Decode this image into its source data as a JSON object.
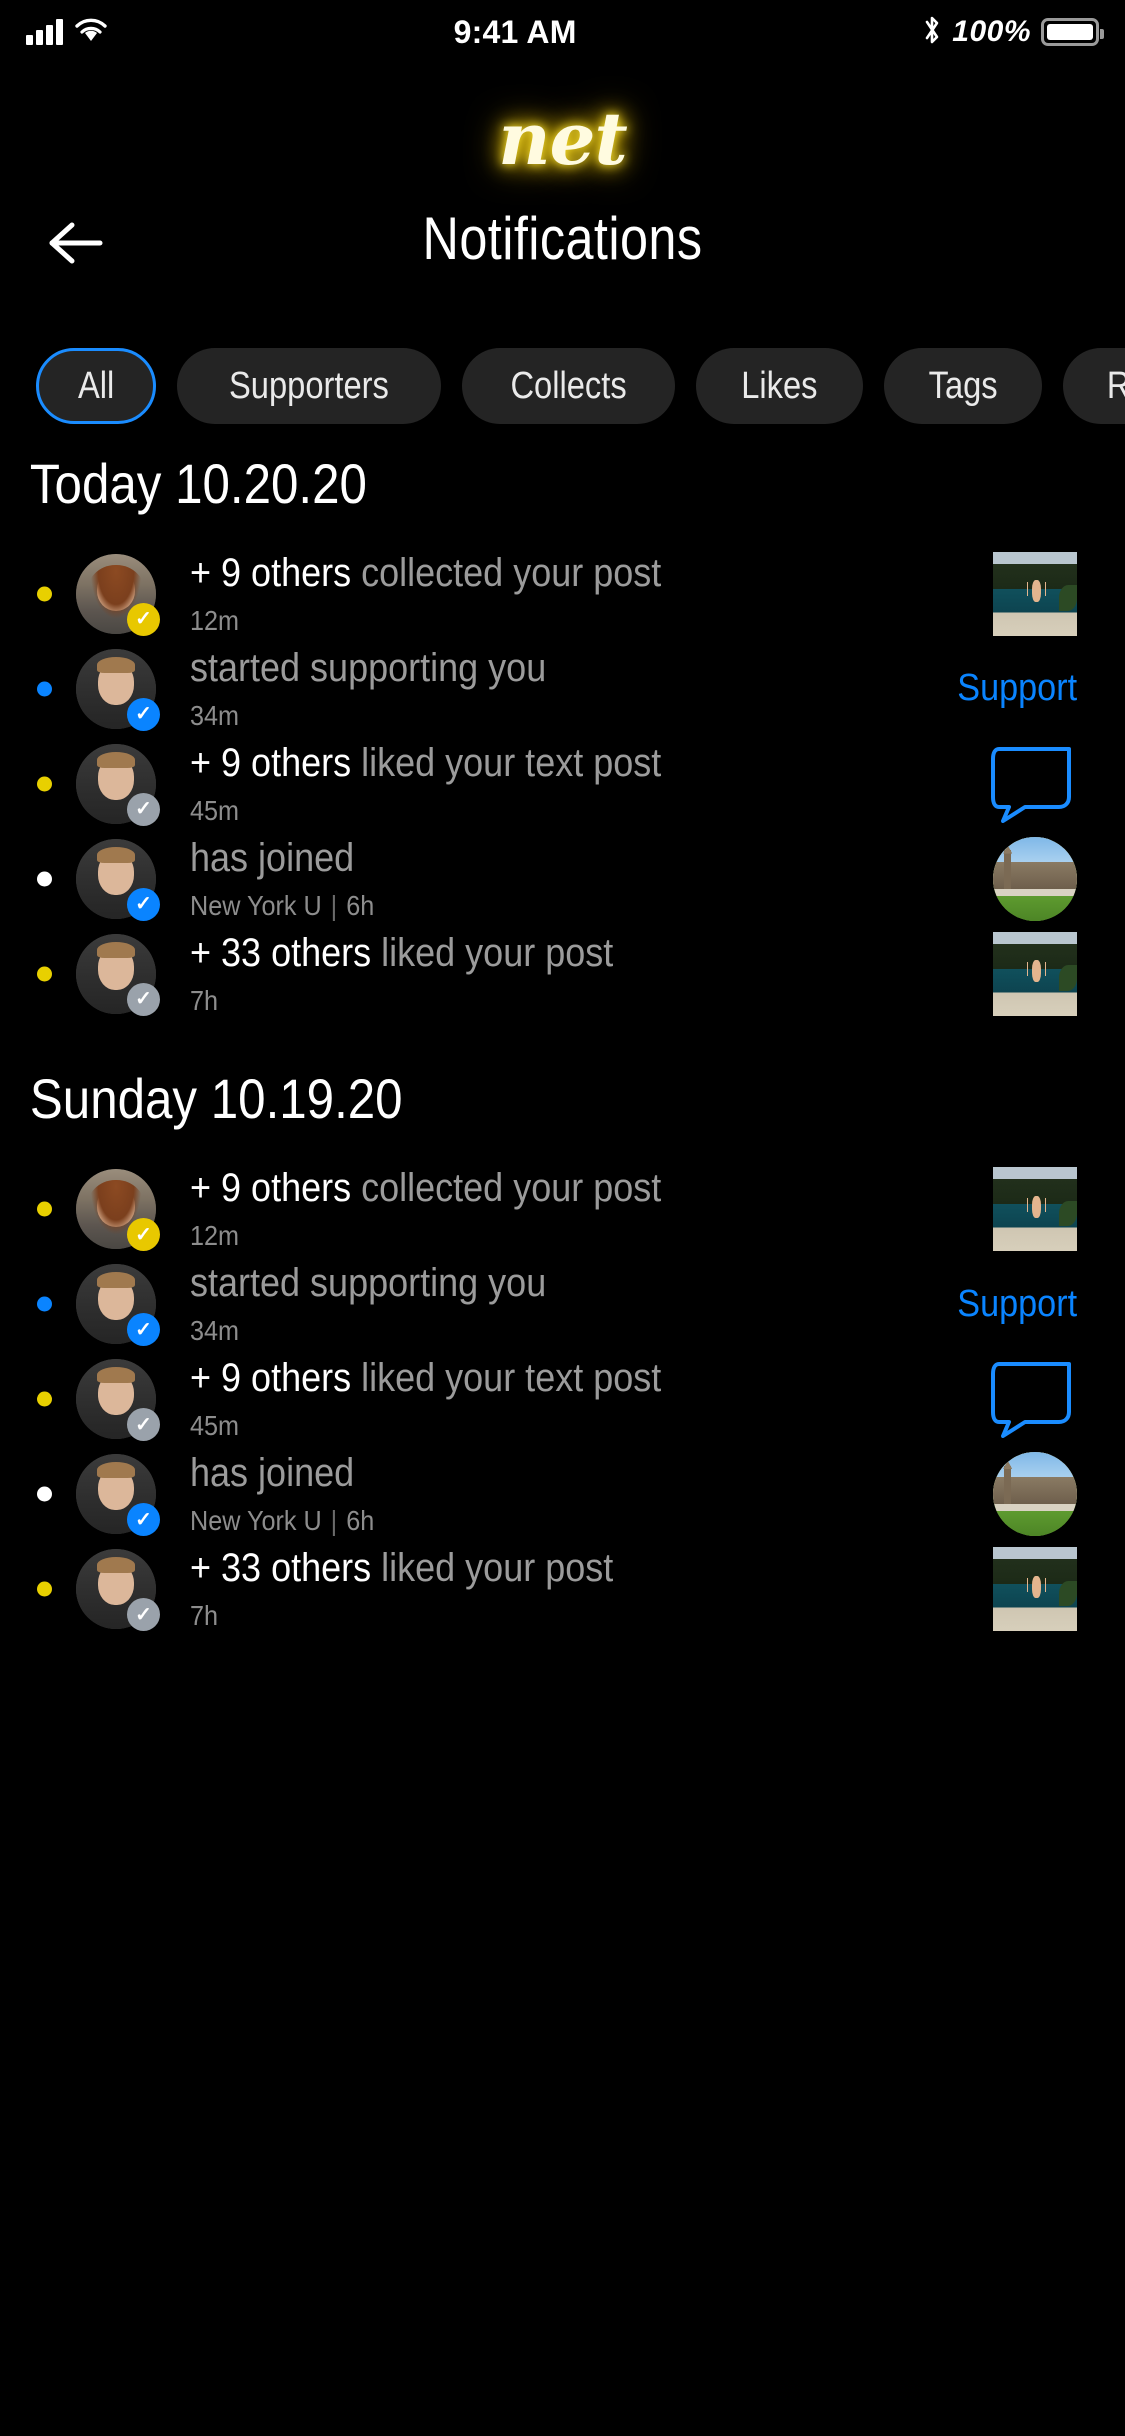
{
  "status_bar": {
    "signal_icon": "cellular-bars-icon",
    "wifi_icon": "wifi-icon",
    "time": "9:41 AM",
    "bluetooth_icon": "bluetooth-icon",
    "battery_percent": "100%",
    "battery_icon": "battery-full-icon"
  },
  "brand": {
    "logo_text": "net",
    "glow_color": "#ffd400"
  },
  "header": {
    "back_icon": "arrow-left-icon",
    "title": "Notifications"
  },
  "filters": {
    "selected": "All",
    "accent": "#1a8cff",
    "chips": [
      {
        "label": "All",
        "active": true
      },
      {
        "label": "Supporters",
        "active": false
      },
      {
        "label": "Collects",
        "active": false
      },
      {
        "label": "Likes",
        "active": false
      },
      {
        "label": "Tags",
        "active": false
      },
      {
        "label": "Rep",
        "active": false
      }
    ]
  },
  "sections": [
    {
      "title": "Today 10.20.20",
      "rows": [
        {
          "dot": "yellow",
          "avatar": "girl",
          "badge": "yellow",
          "badge_icon": "check-badge-icon",
          "strong": "+ 9 others",
          "muted": "collected your post",
          "time": "12m",
          "meta": "",
          "right_type": "thumb-square",
          "right_art": "pool",
          "right_label": ""
        },
        {
          "dot": "blue",
          "avatar": "man",
          "badge": "blue",
          "badge_icon": "verified-badge-icon",
          "strong": "",
          "muted": "started supporting you",
          "time": "34m",
          "meta": "",
          "right_type": "support-link",
          "right_art": "",
          "right_label": "Support"
        },
        {
          "dot": "yellow",
          "avatar": "man",
          "badge": "gray",
          "badge_icon": "check-badge-icon",
          "strong": "+ 9 others",
          "muted": "liked your text post",
          "time": "45m",
          "meta": "",
          "right_type": "bubble",
          "right_art": "",
          "right_label": ""
        },
        {
          "dot": "white",
          "avatar": "man",
          "badge": "blue",
          "badge_icon": "verified-badge-icon",
          "strong": "",
          "muted": "has joined",
          "time": "6h",
          "meta": "New York U",
          "right_type": "thumb-circle",
          "right_art": "campus",
          "right_label": ""
        },
        {
          "dot": "yellow",
          "avatar": "man",
          "badge": "gray",
          "badge_icon": "check-badge-icon",
          "strong": "+ 33 others",
          "muted": "liked your post",
          "time": "7h",
          "meta": "",
          "right_type": "thumb-square",
          "right_art": "pool",
          "right_label": ""
        }
      ]
    },
    {
      "title": "Sunday 10.19.20",
      "rows": [
        {
          "dot": "yellow",
          "avatar": "girl",
          "badge": "yellow",
          "badge_icon": "check-badge-icon",
          "strong": "+ 9 others",
          "muted": "collected your post",
          "time": "12m",
          "meta": "",
          "right_type": "thumb-square",
          "right_art": "pool",
          "right_label": ""
        },
        {
          "dot": "blue",
          "avatar": "man",
          "badge": "blue",
          "badge_icon": "verified-badge-icon",
          "strong": "",
          "muted": "started supporting you",
          "time": "34m",
          "meta": "",
          "right_type": "support-link",
          "right_art": "",
          "right_label": "Support"
        },
        {
          "dot": "yellow",
          "avatar": "man",
          "badge": "gray",
          "badge_icon": "check-badge-icon",
          "strong": "+ 9 others",
          "muted": "liked your text post",
          "time": "45m",
          "meta": "",
          "right_type": "bubble",
          "right_art": "",
          "right_label": ""
        },
        {
          "dot": "white",
          "avatar": "man",
          "badge": "blue",
          "badge_icon": "verified-badge-icon",
          "strong": "",
          "muted": "has joined",
          "time": "6h",
          "meta": "New York U",
          "right_type": "thumb-circle",
          "right_art": "campus",
          "right_label": ""
        },
        {
          "dot": "yellow",
          "avatar": "man",
          "badge": "gray",
          "badge_icon": "check-badge-icon",
          "strong": "+ 33 others",
          "muted": "liked your post",
          "time": "7h",
          "meta": "",
          "right_type": "thumb-square",
          "right_art": "pool",
          "right_label": ""
        }
      ]
    }
  ],
  "colors": {
    "background": "#000000",
    "chip_bg": "#242424",
    "accent_blue": "#0a84ff",
    "unread_yellow": "#e8d000",
    "muted_text": "#9b9b9b"
  }
}
